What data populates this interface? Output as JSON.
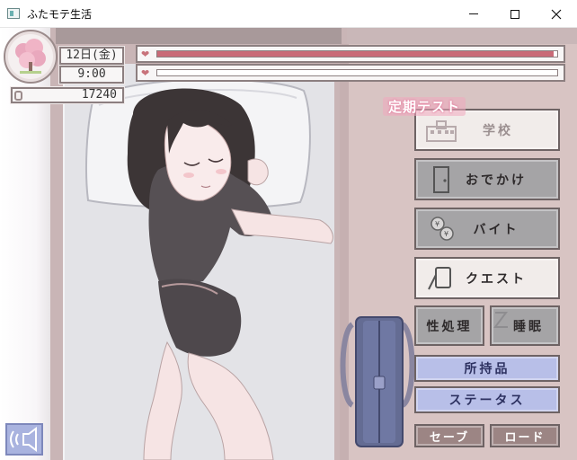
{
  "window": {
    "title": "ふたモテ生活",
    "controls": [
      "minimize",
      "maximize",
      "close"
    ]
  },
  "hud": {
    "date": "12日(金)",
    "time": "9:00",
    "money": "17240",
    "stamina_level": 0.99,
    "affection_level": 0.0
  },
  "event_label": "定期テスト",
  "menu": {
    "school": "学校",
    "outing": "おでかけ",
    "parttime": "バイト",
    "quest": "クエスト",
    "relief": "性処理",
    "sleep": "睡眠",
    "items": "所持品",
    "status": "ステータス",
    "save": "セーブ",
    "load": "ロード"
  },
  "icons": {
    "badge": "sakura-tree-icon",
    "money": "coin-icon",
    "bars": "heart-icon",
    "school": "school-building-icon",
    "outing": "door-icon",
    "parttime": "yen-coins-icon",
    "quest": "notebook-pen-icon",
    "sleep": "zzz-icon",
    "sound": "speaker-icon"
  },
  "colors": {
    "heart": "#c8727a",
    "bar_fill": "#c96a77",
    "blue_button": "#b8bfe8",
    "gray_button": "#a5a4a6",
    "brown_button": "#9c8584"
  }
}
